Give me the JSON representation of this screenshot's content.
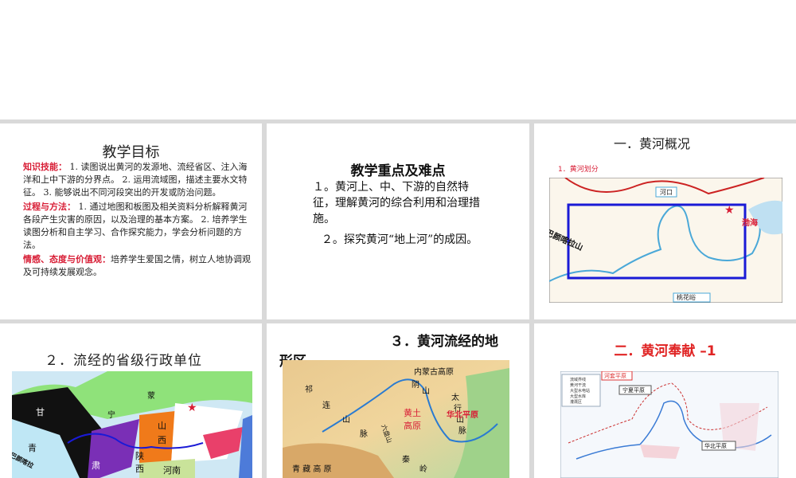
{
  "slide1": {
    "title": "教学目标",
    "k_label": "知识技能：",
    "k_text": " 1. 读图说出黄河的发源地、流经省区、注入海洋和上中下游的分界点。 2. 运用流域图，描述主要水文特征。 3. 能够说出不同河段突出的开发或防治问题。",
    "p_label": "过程与方法：",
    "p_text": " 1. 通过地图和板图及相关资料分析解释黄河各段产生灾害的原因，以及治理的基本方案。 2. 培养学生读图分析和自主学习、合作探究能力，学会分析问题的方法。",
    "e_label": "情感、态度与价值观：",
    "e_text": "培养学生爱国之情，树立人地协调观及可持续发展观念。"
  },
  "slide2": {
    "title": "教学重点及难点",
    "point1": "１。黄河上、中、下游的自然特征，理解黄河的综合利用和治理措施。",
    "point2": "２。探究黄河“地上河”的成因。"
  },
  "slide3": {
    "title": "一．黄河概况",
    "subtitle": "1．黄河划分",
    "label_hekou": "河口",
    "label_taohuayu": "桃花峪",
    "label_bohai": "渤海",
    "label_bayan": "巴颜喀拉山"
  },
  "slide4": {
    "title": "２．流经的省级行政单位",
    "labels": [
      "甘",
      "青",
      "肃",
      "陕",
      "西",
      "山",
      "西",
      "河南",
      "宁",
      "蒙",
      "巴颜喀拉"
    ]
  },
  "slide5": {
    "title_line1": "３．黄河流经的地",
    "title_line2": "形区",
    "labels": [
      "内蒙古高原",
      "阴",
      "山",
      "祁",
      "连",
      "山",
      "脉",
      "太",
      "行",
      "山",
      "脉",
      "黄土",
      "高原",
      "华北平原",
      "六盘山",
      "秦",
      "岭",
      "青 藏 高 原"
    ]
  },
  "slide6": {
    "title": "二．黄河奉献 –1",
    "labels": [
      "河套平原",
      "宁夏平原",
      "华北平原"
    ],
    "legend": [
      "流域界线",
      "黄河干流",
      "大型水电站",
      "大型水库",
      "灌溉区"
    ]
  },
  "colors": {
    "accent_red": "#d81e36",
    "blue_rect": "#1a1ad6",
    "river": "#4aa8d8"
  }
}
